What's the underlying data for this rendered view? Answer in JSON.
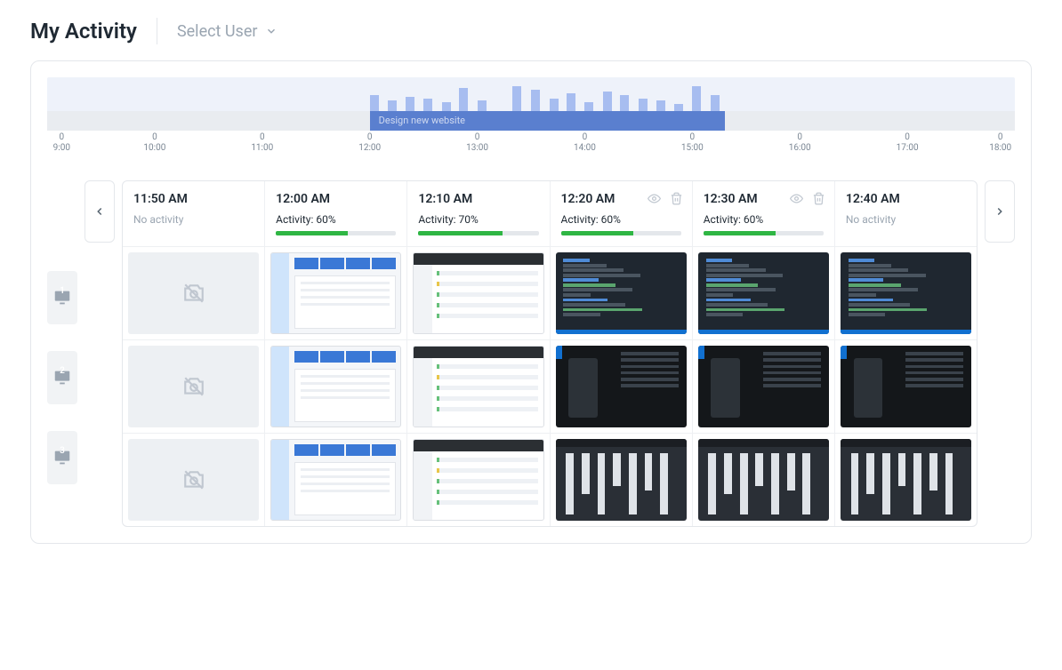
{
  "header": {
    "title": "My Activity",
    "user_select_label": "Select User"
  },
  "chart_data": {
    "type": "bar",
    "title": "",
    "xlabel": "",
    "ylabel": "",
    "x_range_hours": [
      9,
      18
    ],
    "ticks": [
      {
        "time": "9:00",
        "value": 0
      },
      {
        "time": "10:00",
        "value": 0
      },
      {
        "time": "11:00",
        "value": 0
      },
      {
        "time": "12:00",
        "value": 0
      },
      {
        "time": "13:00",
        "value": 0
      },
      {
        "time": "14:00",
        "value": 0
      },
      {
        "time": "15:00",
        "value": 0
      },
      {
        "time": "16:00",
        "value": 0
      },
      {
        "time": "17:00",
        "value": 0
      },
      {
        "time": "18:00",
        "value": 0
      }
    ],
    "bars": [
      {
        "hour": 12.0,
        "value": 18
      },
      {
        "hour": 12.17,
        "value": 12
      },
      {
        "hour": 12.33,
        "value": 16
      },
      {
        "hour": 12.5,
        "value": 14
      },
      {
        "hour": 12.67,
        "value": 10
      },
      {
        "hour": 12.83,
        "value": 26
      },
      {
        "hour": 13.0,
        "value": 12
      },
      {
        "hour": 13.33,
        "value": 28
      },
      {
        "hour": 13.5,
        "value": 24
      },
      {
        "hour": 13.67,
        "value": 14
      },
      {
        "hour": 13.83,
        "value": 20
      },
      {
        "hour": 14.0,
        "value": 10
      },
      {
        "hour": 14.17,
        "value": 22
      },
      {
        "hour": 14.33,
        "value": 18
      },
      {
        "hour": 14.5,
        "value": 14
      },
      {
        "hour": 14.67,
        "value": 12
      },
      {
        "hour": 14.83,
        "value": 8
      },
      {
        "hour": 15.0,
        "value": 28
      },
      {
        "hour": 15.17,
        "value": 18
      }
    ],
    "task": {
      "label": "Design new website",
      "start_hour": 12.0,
      "end_hour": 15.3
    }
  },
  "slots": [
    {
      "time": "11:50 AM",
      "no_activity_label": "No activity",
      "activity_pct": null,
      "show_actions": false
    },
    {
      "time": "12:00 AM",
      "activity_label": "Activity: 60%",
      "activity_pct": 60,
      "show_actions": false
    },
    {
      "time": "12:10 AM",
      "activity_label": "Activity: 70%",
      "activity_pct": 70,
      "show_actions": false
    },
    {
      "time": "12:20 AM",
      "activity_label": "Activity: 60%",
      "activity_pct": 60,
      "show_actions": true
    },
    {
      "time": "12:30 AM",
      "activity_label": "Activity: 60%",
      "activity_pct": 60,
      "show_actions": true
    },
    {
      "time": "12:40 AM",
      "no_activity_label": "No activity",
      "activity_pct": null,
      "show_actions": false
    }
  ],
  "monitors": [
    {
      "num": "1"
    },
    {
      "num": "2"
    },
    {
      "num": "3"
    }
  ],
  "thumbnails": {
    "row1": [
      "empty",
      "light",
      "browser",
      "code",
      "code",
      "code"
    ],
    "row2": [
      "empty",
      "light",
      "browser",
      "phone",
      "phone",
      "phone"
    ],
    "row3": [
      "empty",
      "light",
      "browser",
      "editor",
      "editor",
      "editor"
    ]
  }
}
